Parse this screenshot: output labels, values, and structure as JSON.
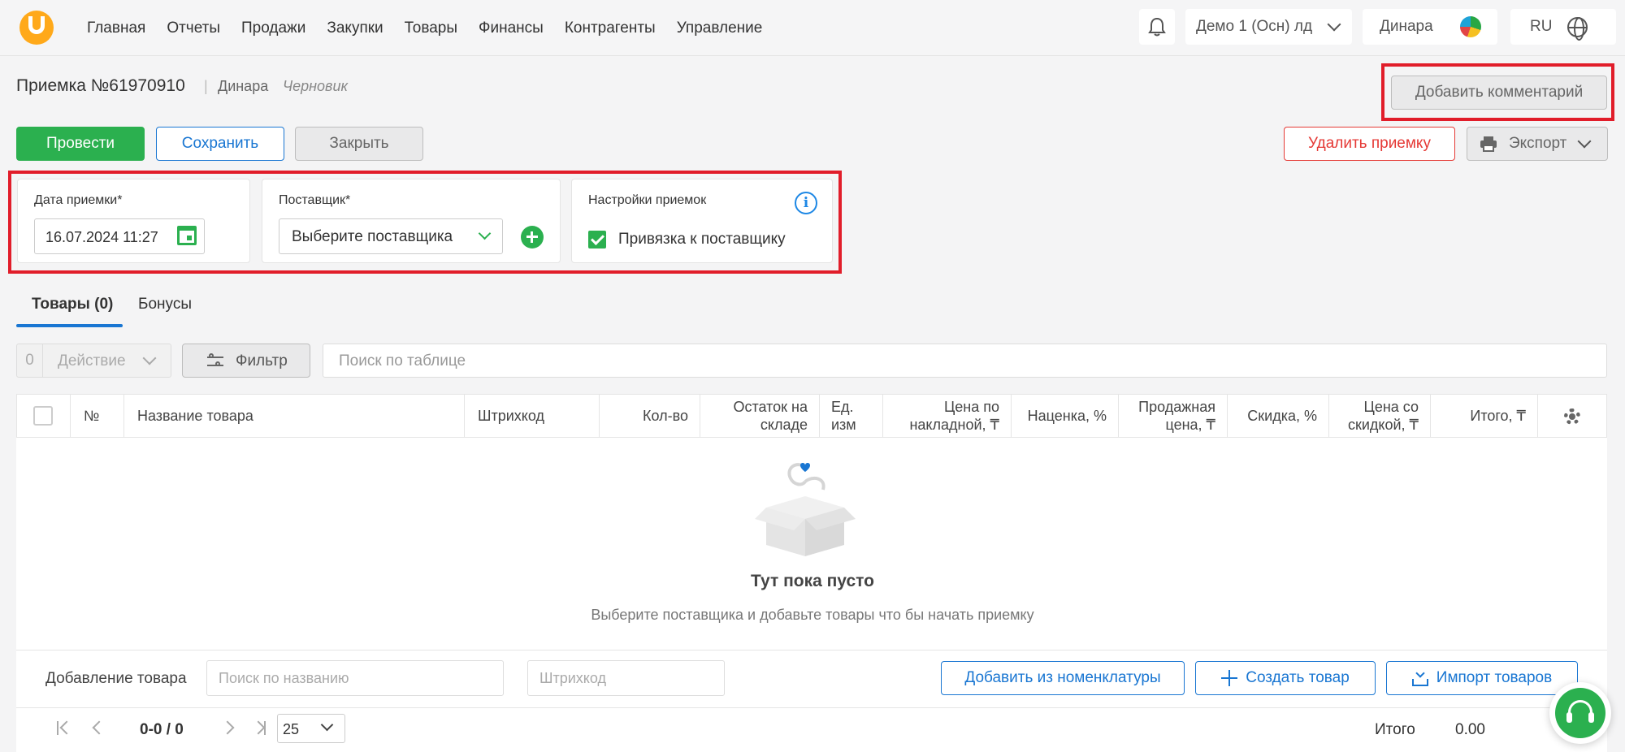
{
  "nav": {
    "items": [
      "Главная",
      "Отчеты",
      "Продажи",
      "Закупки",
      "Товары",
      "Финансы",
      "Контрагенты",
      "Управление"
    ],
    "org": "Демо 1 (Осн) лд",
    "user": "Динара",
    "lang": "RU",
    "icons": {
      "bell": "bell-icon",
      "globe": "globe-icon",
      "logo": "brand-logo"
    }
  },
  "header": {
    "title": "Приемка №61970910",
    "separator": "|",
    "author": "Динара",
    "status": "Черновик",
    "add_comment": "Добавить комментарий"
  },
  "actions": {
    "post": "Провести",
    "save": "Сохранить",
    "close": "Закрыть",
    "delete": "Удалить приемку",
    "export": "Экспорт"
  },
  "form": {
    "date_label": "Дата приемки*",
    "date_value": "16.07.2024 11:27",
    "supplier_label": "Поставщик*",
    "supplier_placeholder": "Выберите поставщика",
    "settings_label": "Настройки приемок",
    "bind_supplier_label": "Привязка к поставщику",
    "bind_supplier_checked": true
  },
  "tabs": [
    {
      "label": "Товары (0)",
      "active": true
    },
    {
      "label": "Бонусы",
      "active": false
    }
  ],
  "toolbar": {
    "selected_count": "0",
    "action_label": "Действие",
    "filter_label": "Фильтр",
    "search_placeholder": "Поиск по таблице"
  },
  "table": {
    "columns": [
      "№",
      "Название товара",
      "Штрихкод",
      "Кол-во",
      "Остаток на складе",
      "Ед. изм",
      "Цена по накладной, ₸",
      "Наценка, %",
      "Продажная цена, ₸",
      "Скидка, %",
      "Цена со скидкой, ₸",
      "Итого, ₸"
    ],
    "rows": [],
    "empty_title": "Тут пока пусто",
    "empty_subtitle": "Выберите поставщика и добавьте товары что бы начать приемку"
  },
  "add_product": {
    "label": "Добавление товара",
    "name_placeholder": "Поиск по названию",
    "barcode_placeholder": "Штрихкод",
    "from_catalog": "Добавить из номенклатуры",
    "create": "Создать товар",
    "import": "Импорт товаров"
  },
  "pagination": {
    "range": "0-0 / 0",
    "page_size": "25",
    "total_label": "Итого",
    "total_value": "0.00"
  },
  "colors": {
    "primary_green": "#2bb04f",
    "accent_blue": "#1976d2",
    "danger_red": "#e53935",
    "highlight_frame": "#e11d2a",
    "brand_orange": "#ffa91a"
  }
}
